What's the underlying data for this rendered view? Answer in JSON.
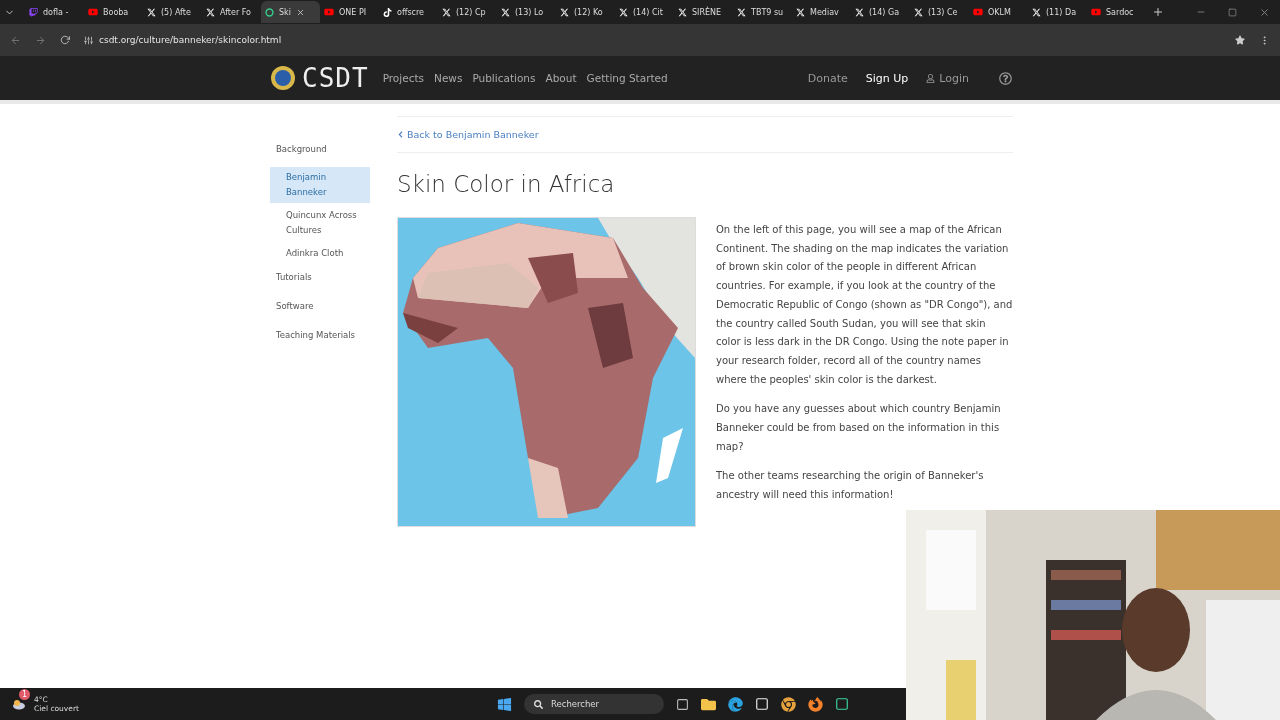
{
  "browser": {
    "tabs": [
      {
        "title": "dofla -",
        "kind": "stream",
        "selected": false
      },
      {
        "title": "Booba",
        "kind": "video",
        "selected": false
      },
      {
        "title": "(5) Afte",
        "kind": "post",
        "selected": false
      },
      {
        "title": "After Fo",
        "kind": "post",
        "selected": false
      },
      {
        "title": "Ski",
        "kind": "site",
        "selected": true
      },
      {
        "title": "ONE PI",
        "kind": "video",
        "selected": false
      },
      {
        "title": "offscre",
        "kind": "clip",
        "selected": false
      },
      {
        "title": "(12) Cp",
        "kind": "post",
        "selected": false
      },
      {
        "title": "(13) Lo",
        "kind": "post",
        "selected": false
      },
      {
        "title": "(12) Ko",
        "kind": "post",
        "selected": false
      },
      {
        "title": "(14) Cit",
        "kind": "post",
        "selected": false
      },
      {
        "title": "SIRÈNE",
        "kind": "post",
        "selected": false
      },
      {
        "title": "TBT9 su",
        "kind": "post",
        "selected": false
      },
      {
        "title": "Mediav",
        "kind": "post",
        "selected": false
      },
      {
        "title": "(14) Ga",
        "kind": "post",
        "selected": false
      },
      {
        "title": "(13) Ce",
        "kind": "post",
        "selected": false
      },
      {
        "title": "OKLM",
        "kind": "video",
        "selected": false
      },
      {
        "title": "(11) Da",
        "kind": "post",
        "selected": false
      },
      {
        "title": "Sardoc",
        "kind": "video",
        "selected": false
      }
    ],
    "address": "csdt.org/culture/banneker/skincolor.html"
  },
  "site_nav": {
    "logo": "CSDT",
    "links": [
      "Projects",
      "News",
      "Publications",
      "About",
      "Getting Started"
    ],
    "donate": "Donate",
    "sign_up": "Sign Up",
    "login": "Login"
  },
  "sidebar": [
    {
      "label": "Background",
      "selected": false,
      "children": [
        {
          "label": "Benjamin Banneker",
          "selected": true
        },
        {
          "label": "Quincunx Across Cultures",
          "selected": false
        },
        {
          "label": "Adinkra Cloth",
          "selected": false
        }
      ]
    },
    {
      "label": "Tutorials",
      "selected": false
    },
    {
      "label": "Software",
      "selected": false
    },
    {
      "label": "Teaching Materials",
      "selected": false
    }
  ],
  "back_link": "Back to Benjamin Banneker",
  "title": "Skin Color in Africa",
  "map": {
    "kind": "picture"
  },
  "paragraphs": [
    "On the left of this page, you will see a map of the African Continent. The shading on the map indicates the variation of brown skin color of the people in different African countries. For example, if you look at the country of the Democratic Republic of Congo (shown as \"DR Congo\"), and the country called South Sudan, you will see that skin color is less dark in the DR Congo. Using the note paper in your research folder, record all of the country names where the peoples' skin color is the darkest.",
    "Do you have any guesses about which country Benjamin Banneker could be from based on the information in this map?",
    "The other teams researching the origin of Banneker's ancestry will need this information!"
  ],
  "taskbar": {
    "temperature": "4°C",
    "weather": "Ciel couvert",
    "badge": "1",
    "search": "Rechercher"
  },
  "webcam": {
    "kind": "picture"
  }
}
